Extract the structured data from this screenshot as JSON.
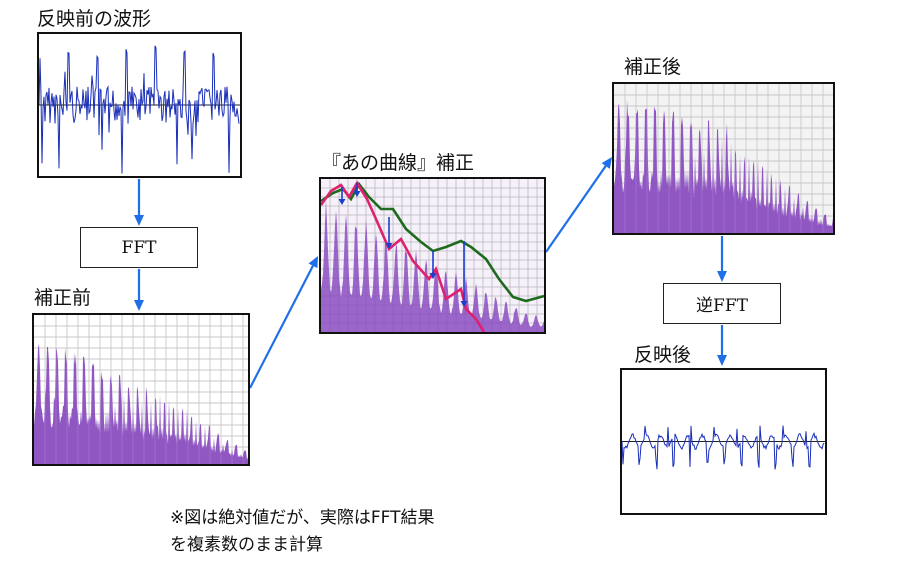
{
  "labels": {
    "wave_before": "反映前の波形",
    "spectrum_before": "補正前",
    "curve_correction": "『あの曲線』補正",
    "spectrum_after": "補正後",
    "wave_after": "反映後"
  },
  "steps": {
    "fft": "FFT",
    "ifft": "逆FFT"
  },
  "note": {
    "line1": "※図は絶対値だが、実際はFFT結果",
    "line2": "を複素数のまま計算"
  },
  "colors": {
    "arrow": "#1f6fe8",
    "spectrum_fill": "#8a4ec0",
    "grid": "#b8b8b8",
    "wave": "#1a2fb8",
    "curve_original": "#e0206e",
    "curve_target": "#1e6a1e",
    "correction_arrow": "#1a3fd0"
  }
}
